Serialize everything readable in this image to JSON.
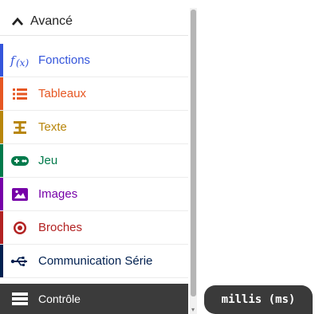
{
  "toolbox": {
    "header": {
      "label": "Avancé",
      "icon": "chevron-up-icon"
    },
    "categories": [
      {
        "label": "Fonctions",
        "icon": "function-icon",
        "color": "#3455db"
      },
      {
        "label": "Tableaux",
        "icon": "list-icon",
        "color": "#e65722"
      },
      {
        "label": "Texte",
        "icon": "text-icon",
        "color": "#b8860b"
      },
      {
        "label": "Jeu",
        "icon": "gamepad-icon",
        "color": "#007a4b"
      },
      {
        "label": "Images",
        "icon": "image-icon",
        "color": "#7600a8"
      },
      {
        "label": "Broches",
        "icon": "target-icon",
        "color": "#b22222"
      },
      {
        "label": "Communication Série",
        "icon": "usb-icon",
        "color": "#002050"
      },
      {
        "label": "Contrôle",
        "icon": "server-icon",
        "color": "#333333"
      }
    ]
  },
  "tooltip": {
    "text": "millis (ms)"
  }
}
